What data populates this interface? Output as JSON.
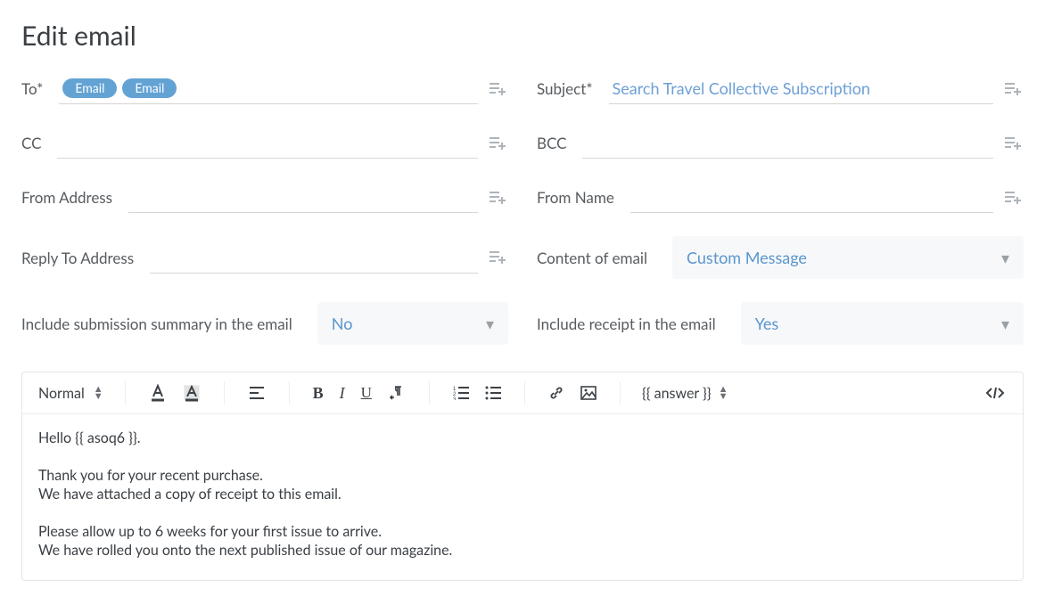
{
  "title": "Edit email",
  "fields": {
    "to": {
      "label": "To*",
      "chips": [
        "Email",
        "Email"
      ]
    },
    "subject": {
      "label": "Subject*",
      "value": "Search Travel Collective Subscription"
    },
    "cc": {
      "label": "CC"
    },
    "bcc": {
      "label": "BCC"
    },
    "from_address": {
      "label": "From Address"
    },
    "from_name": {
      "label": "From Name"
    },
    "reply_to": {
      "label": "Reply To Address"
    },
    "content_of_email": {
      "label": "Content of email",
      "value": "Custom Message"
    },
    "include_summary": {
      "label": "Include submission summary in the email",
      "value": "No"
    },
    "include_receipt": {
      "label": "Include receipt in the email",
      "value": "Yes"
    }
  },
  "toolbar": {
    "heading": "Normal",
    "answer": "{{ answer }}"
  },
  "body_lines": [
    "Hello {{ asoq6 }}.",
    "",
    "Thank you for your recent purchase.",
    "We have attached a copy of receipt to this email.",
    "",
    "Please allow up to 6 weeks for your first issue to arrive.",
    "We have rolled you onto the next published issue of our magazine."
  ]
}
